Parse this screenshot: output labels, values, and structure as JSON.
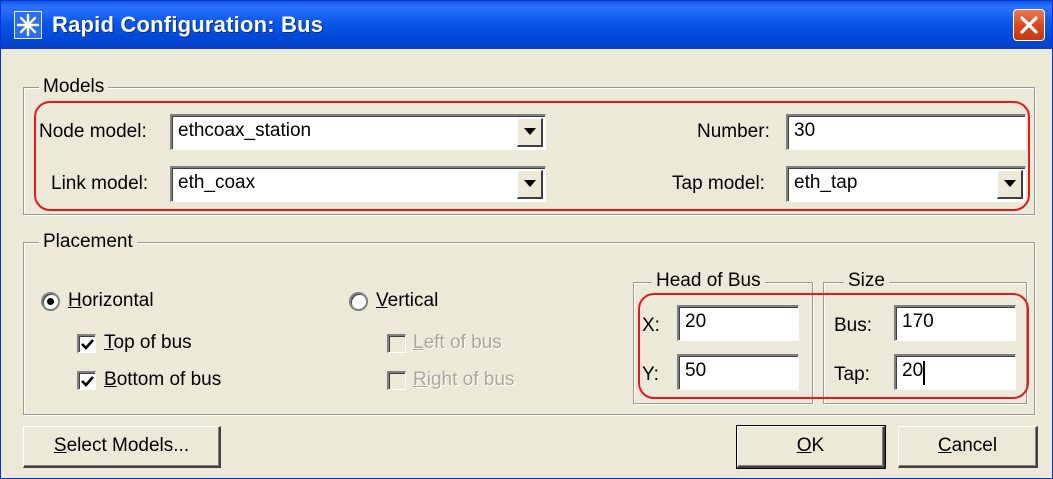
{
  "window": {
    "title": "Rapid Configuration: Bus",
    "accent": "#0a57e8"
  },
  "models": {
    "group_label": "Models",
    "node_model_label": "Node model:",
    "node_model_value": "ethcoax_station",
    "link_model_label": "Link model:",
    "link_model_value": "eth_coax",
    "number_label": "Number:",
    "number_value": "30",
    "tap_model_label": "Tap model:",
    "tap_model_value": "eth_tap"
  },
  "placement": {
    "group_label": "Placement",
    "horizontal": {
      "label_u": "H",
      "label_rest": "orizontal",
      "selected": true
    },
    "top_of_bus": {
      "label_u": "T",
      "label_rest": "op of bus",
      "checked": true
    },
    "bottom_of_bus": {
      "label_u": "B",
      "label_rest": "ottom of bus",
      "checked": true
    },
    "vertical": {
      "label_u": "V",
      "label_rest": "ertical",
      "selected": false
    },
    "left_of_bus": {
      "label_u": "L",
      "label_rest": "eft of bus",
      "checked": false,
      "disabled": true
    },
    "right_of_bus": {
      "label_u": "R",
      "label_rest": "ight of bus",
      "checked": false,
      "disabled": true
    },
    "head_of_bus": {
      "group_label": "Head of Bus",
      "x_label": "X:",
      "x_value": "20",
      "y_label": "Y:",
      "y_value": "50"
    },
    "size": {
      "group_label": "Size",
      "bus_label": "Bus:",
      "bus_value": "170",
      "tap_label": "Tap:",
      "tap_value": "20"
    }
  },
  "buttons": {
    "select_models": {
      "label_u": "S",
      "label_rest": "elect Models..."
    },
    "ok": {
      "label_u": "O",
      "label_rest": "K"
    },
    "cancel": {
      "label_u": "C",
      "label_rest": "ancel"
    }
  },
  "icons": {
    "title": "star-burst-icon",
    "close": "close-x-icon",
    "dropdown": "triangle-down-icon",
    "check": "check-mark-icon"
  },
  "annotation_color": "#e2191f"
}
